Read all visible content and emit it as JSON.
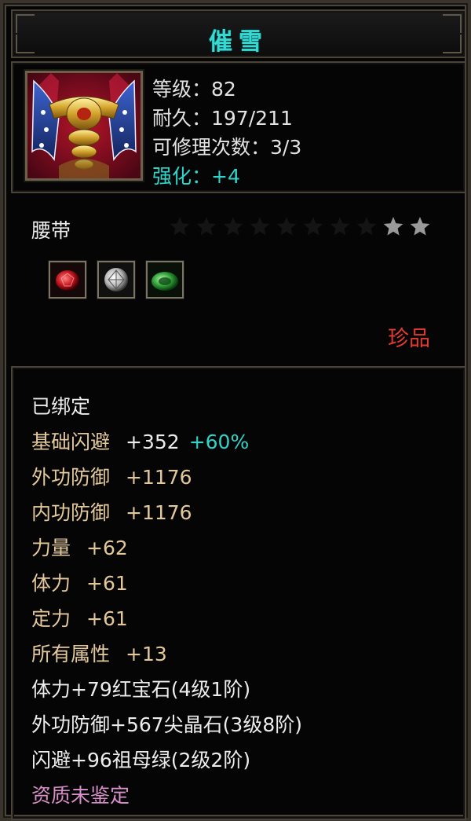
{
  "item": {
    "name": "催雪",
    "type": "腰带",
    "rarity": "珍品",
    "stars": 2,
    "max_stars": 10
  },
  "stats": {
    "level": "等级：82",
    "durability": "耐久：197/211",
    "repairs": "可修理次数：3/3",
    "enhance": "强化：+4"
  },
  "gems": [
    {
      "name": "ruby-gem-icon",
      "color": "#c0141c"
    },
    {
      "name": "diamond-gem-icon",
      "color": "#d8d8d8"
    },
    {
      "name": "emerald-gem-icon",
      "color": "#2c9a34"
    }
  ],
  "attributes": {
    "bound": "已绑定",
    "dodge_label": "基础闪避",
    "dodge_val": "+352",
    "dodge_pct": "+60%",
    "ext_def_label": "外功防御",
    "ext_def_val": "+1176",
    "int_def_label": "内功防御",
    "int_def_val": "+1176",
    "str_label": "力量",
    "str_val": "+62",
    "vit_label": "体力",
    "vit_val": "+61",
    "foc_label": "定力",
    "foc_val": "+61",
    "all_label": "所有属性",
    "all_val": "+13",
    "gem_line_1": "体力+79红宝石(4级1阶)",
    "gem_line_2": "外功防御+567尖晶石(3级8阶)",
    "gem_line_3": "闪避+96祖母绿(2级2阶)",
    "quality": "资质未鉴定"
  },
  "colors": {
    "title": "#37d9d2",
    "rarity": "#e33a30",
    "attribute_gold": "#e3c89a",
    "quality_pink": "#d98fc9"
  }
}
